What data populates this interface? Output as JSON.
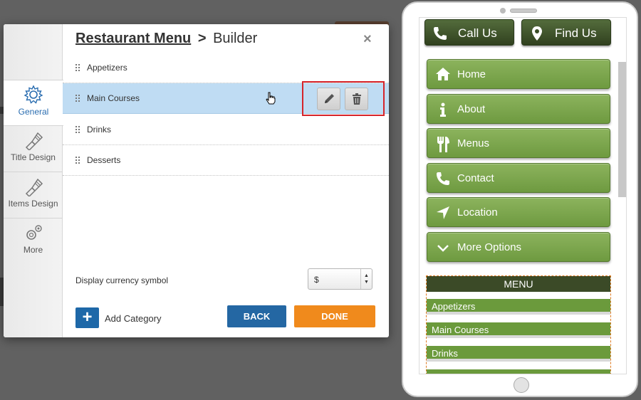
{
  "dialog": {
    "title_link": "Restaurant Menu",
    "title_sep": ">",
    "title_rest": "Builder",
    "close_label": "×"
  },
  "sidebar": {
    "tabs": [
      {
        "label": "General",
        "icon": "gear-icon",
        "active": true
      },
      {
        "label": "Title Design",
        "icon": "brush-icon",
        "active": false
      },
      {
        "label": "Items Design",
        "icon": "brush-icon",
        "active": false
      },
      {
        "label": "More",
        "icon": "gears-icon",
        "active": false
      }
    ]
  },
  "categories": [
    {
      "label": "Appetizers",
      "selected": false
    },
    {
      "label": "Main Courses",
      "selected": true
    },
    {
      "label": "Drinks",
      "selected": false
    },
    {
      "label": "Desserts",
      "selected": false
    }
  ],
  "footer": {
    "currency_label": "Display currency symbol",
    "currency_value": "$",
    "add_label": "Add Category",
    "add_icon": "+",
    "back_label": "BACK",
    "done_label": "DONE"
  },
  "preview": {
    "top_buttons": [
      {
        "label": "Call Us",
        "icon": "phone-icon"
      },
      {
        "label": "Find Us",
        "icon": "map-pin-icon"
      }
    ],
    "nav": [
      {
        "label": "Home",
        "icon": "home-icon"
      },
      {
        "label": "About",
        "icon": "info-icon"
      },
      {
        "label": "Menus",
        "icon": "fork-knife-icon"
      },
      {
        "label": "Contact",
        "icon": "phone-icon"
      },
      {
        "label": "Location",
        "icon": "location-arrow-icon"
      },
      {
        "label": "More Options",
        "icon": "chevron-down-icon"
      }
    ],
    "menu_title": "MENU",
    "menu_items": [
      "Appetizers",
      "Main Courses",
      "Drinks"
    ]
  },
  "colors": {
    "accent_blue": "#2467a3",
    "done_orange": "#f08a1c",
    "selection": "#bfdcf3",
    "nav_green": "#7aa54b",
    "dark_green": "#3b4a27",
    "highlight_red": "#d6242a"
  }
}
